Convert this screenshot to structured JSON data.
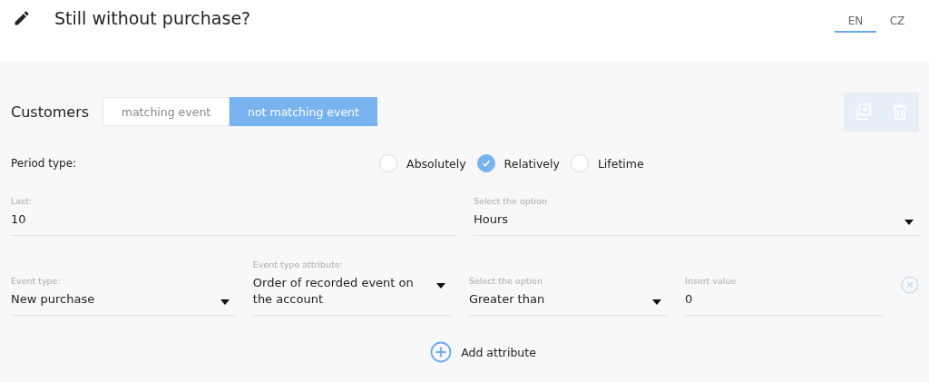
{
  "header": {
    "title": "Still without purchase?",
    "languages": [
      {
        "label": "EN",
        "selected": true
      },
      {
        "label": "CZ",
        "selected": false
      }
    ]
  },
  "condition": {
    "label": "Customers",
    "match_options": [
      {
        "label": "matching event",
        "selected": false
      },
      {
        "label": "not matching event",
        "selected": true
      }
    ],
    "period": {
      "label": "Period type:",
      "options": [
        {
          "label": "Absolutely",
          "selected": false
        },
        {
          "label": "Relatively",
          "selected": true
        },
        {
          "label": "Lifetime",
          "selected": false
        }
      ]
    },
    "last": {
      "label": "Last:",
      "value": "10"
    },
    "unit": {
      "label": "Select the option",
      "value": "Hours"
    },
    "event_fields": [
      {
        "kind": "select",
        "label": "Event type:",
        "value": "New purchase"
      },
      {
        "kind": "select",
        "label": "Event type attribute:",
        "value": "Order of recorded event on the account"
      },
      {
        "kind": "select",
        "label": "Select the option",
        "value": "Greater than"
      },
      {
        "kind": "input",
        "label": "Insert value",
        "value": "0"
      }
    ],
    "add_button": "Add attribute"
  }
}
